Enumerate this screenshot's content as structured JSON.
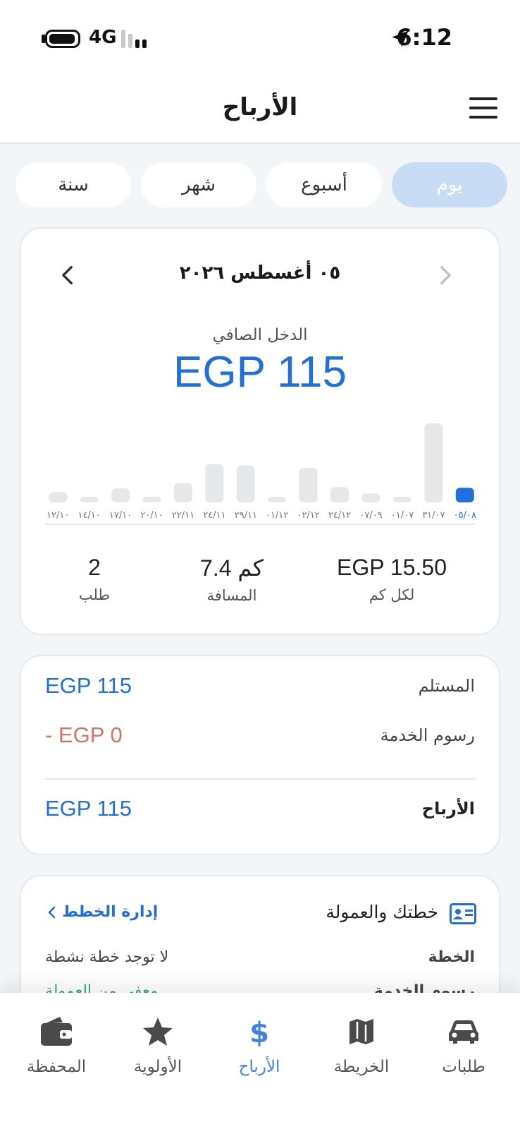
{
  "status_bar": {
    "network": "4G",
    "time": "6:12"
  },
  "header": {
    "title": "الأرباح"
  },
  "tabs": [
    {
      "label": "يوم",
      "active": true
    },
    {
      "label": "أسبوع",
      "active": false
    },
    {
      "label": "شهر",
      "active": false
    },
    {
      "label": "سنة",
      "active": false
    }
  ],
  "summary": {
    "date": "٠٥ أغسطس ٢٠٢٦",
    "net_income_label": "الدخل الصافي",
    "net_income_value": "EGP 115",
    "stats": [
      {
        "value": "EGP 15.50",
        "label": "لكل كم"
      },
      {
        "value": "7.4 كم",
        "label": "المسافة"
      },
      {
        "value": "2",
        "label": "طلب"
      }
    ]
  },
  "chart_data": {
    "type": "bar",
    "categories": [
      "٠٥/٠٨",
      "٣١/٠٧",
      "٠١/٠٧",
      "٠٧/٠٩",
      "٢٤/١٢",
      "٠٢/١٢",
      "٠١/١٢",
      "٢٩/١١",
      "٢٤/١١",
      "٢٢/١١",
      "٢٠/١٠",
      "١٧/١٠",
      "١٤/١٠",
      "١٢/١٠"
    ],
    "values": [
      115,
      620,
      45,
      70,
      120,
      270,
      35,
      290,
      300,
      150,
      35,
      110,
      30,
      80
    ],
    "selected_index": 0,
    "colors": {
      "selected": "#1f6fe0",
      "bar": "#e6e7e9",
      "selected_label": "#1f6fe0",
      "label": "#777777"
    }
  },
  "breakdown": {
    "received_label": "المستلم",
    "received_value": "EGP 115",
    "fees_label": "رسوم الخدمة",
    "fees_value": "- EGP 0",
    "earnings_label": "الأرباح",
    "earnings_value": "EGP 115"
  },
  "plan": {
    "title": "خطتك والعمولة",
    "manage_label": "إدارة الخطط",
    "plan_key": "الخطة",
    "plan_value": "لا توجد خطة نشطة",
    "fees_key": "رسوم الخدمة",
    "fees_value": "معفى من العمولة"
  },
  "bottom_nav": [
    {
      "label": "طلبات",
      "icon": "car-icon",
      "active": false
    },
    {
      "label": "الخريطة",
      "icon": "map-icon",
      "active": false
    },
    {
      "label": "الأرباح",
      "icon": "dollar-icon",
      "active": true
    },
    {
      "label": "الأولوية",
      "icon": "star-icon",
      "active": false
    },
    {
      "label": "المحفظة",
      "icon": "wallet-icon",
      "active": false
    }
  ],
  "colors": {
    "accent": "#1f6fe0",
    "nav_active": "#3e82e4",
    "negative": "#d9706b",
    "positive": "#2fae6a",
    "tab_active_bg": "#c9dcf6"
  }
}
